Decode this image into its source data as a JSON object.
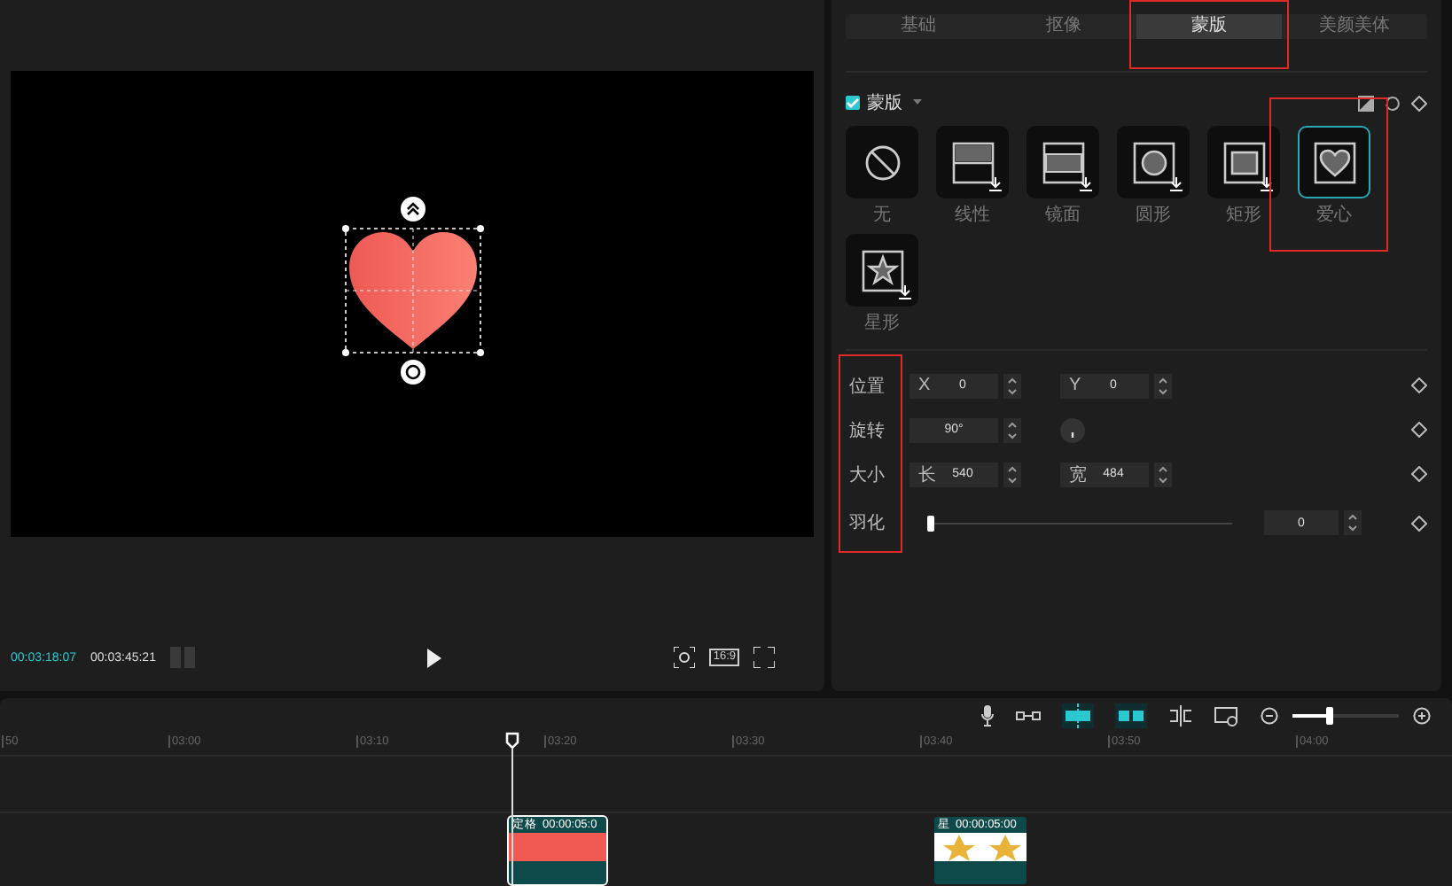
{
  "player": {
    "current_time": "00:03:18:07",
    "total_time": "00:03:45:21",
    "ratio": "16:9"
  },
  "tabs": [
    {
      "label": "基础",
      "selected": false,
      "highlighted": false
    },
    {
      "label": "抠像",
      "selected": false,
      "highlighted": false
    },
    {
      "label": "蒙版",
      "selected": true,
      "highlighted": true
    },
    {
      "label": "美颜美体",
      "selected": false,
      "highlighted": false
    }
  ],
  "mask": {
    "enabled": true,
    "title": "蒙版",
    "items": [
      {
        "kind": "none",
        "label": "无",
        "selected": false,
        "download": false,
        "highlighted": false
      },
      {
        "kind": "linear",
        "label": "线性",
        "selected": false,
        "download": true,
        "highlighted": false
      },
      {
        "kind": "mirror",
        "label": "镜面",
        "selected": false,
        "download": true,
        "highlighted": false
      },
      {
        "kind": "circle",
        "label": "圆形",
        "selected": false,
        "download": true,
        "highlighted": false
      },
      {
        "kind": "rect",
        "label": "矩形",
        "selected": false,
        "download": true,
        "highlighted": false
      },
      {
        "kind": "heart",
        "label": "爱心",
        "selected": true,
        "download": false,
        "highlighted": true
      },
      {
        "kind": "star",
        "label": "星形",
        "selected": false,
        "download": true,
        "highlighted": false
      }
    ]
  },
  "properties": {
    "highlighted": true,
    "rows": [
      {
        "kind": "pair",
        "label": "位置",
        "fields": [
          {
            "prefix": "X",
            "value": "0"
          },
          {
            "prefix": "Y",
            "value": "0"
          }
        ]
      },
      {
        "kind": "angle",
        "label": "旋转",
        "fields": [
          {
            "value": "90°"
          }
        ]
      },
      {
        "kind": "pair",
        "label": "大小",
        "fields": [
          {
            "prefix": "长",
            "value": "540"
          },
          {
            "prefix": "宽",
            "value": "484"
          }
        ]
      },
      {
        "kind": "slider",
        "label": "羽化",
        "level": 0,
        "fields": [
          {
            "value": "0"
          }
        ]
      }
    ]
  },
  "timeline": {
    "zoom": {
      "level": 0.35
    },
    "ticks": [
      "50",
      "03:00",
      "03:10",
      "03:20",
      "03:30",
      "03:40",
      "03:50",
      "04:00"
    ],
    "clips": [
      {
        "kind": "heart",
        "name": "定格",
        "duration": "00:00:05:0"
      },
      {
        "kind": "star",
        "name": "星",
        "duration": "00:00:05:00"
      }
    ]
  }
}
